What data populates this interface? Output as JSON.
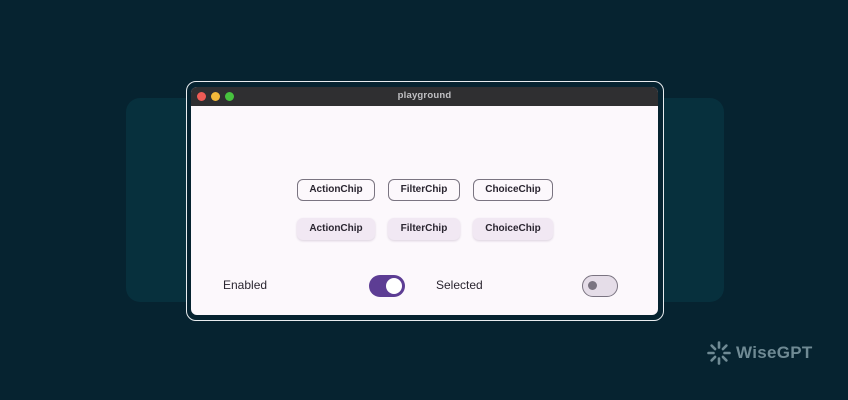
{
  "window": {
    "title": "playground"
  },
  "chips": {
    "outlined": [
      {
        "label": "ActionChip"
      },
      {
        "label": "FilterChip"
      },
      {
        "label": "ChoiceChip"
      }
    ],
    "filled": [
      {
        "label": "ActionChip"
      },
      {
        "label": "FilterChip"
      },
      {
        "label": "ChoiceChip"
      }
    ]
  },
  "controls": {
    "enabled_label": "Enabled",
    "enabled_value": true,
    "selected_label": "Selected",
    "selected_value": false
  },
  "brand": {
    "name": "WiseGPT"
  },
  "colors": {
    "background": "#062330",
    "window_surface": "#fcf8fc",
    "switch_on": "#5d3d94",
    "chip_outline": "#7a7481",
    "chip_filled": "#f1e8f3"
  },
  "icons": {
    "brand": "wisegpt-logo-icon",
    "window_controls": [
      "close-dot-icon",
      "minimize-dot-icon",
      "zoom-dot-icon"
    ]
  }
}
